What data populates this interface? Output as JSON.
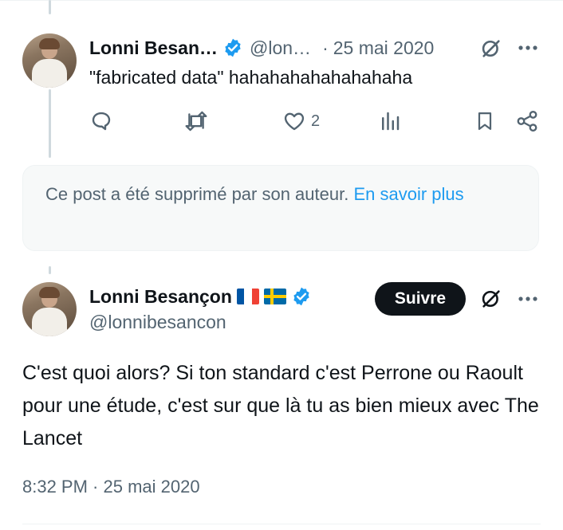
{
  "reply": {
    "author_name": "Lonni Besan…",
    "author_handle": "@lon…",
    "separator": "·",
    "date": "25 mai 2020",
    "text": "\"fabricated data\" hahahahahahahahaha",
    "likes": "2"
  },
  "deleted_notice": {
    "text": "Ce post a été supprimé par son auteur.",
    "link": "En savoir plus"
  },
  "main_tweet": {
    "author_name": "Lonni Besançon",
    "author_handle": "@lonnibesancon",
    "follow_label": "Suivre",
    "text": "C'est quoi alors? Si ton standard c'est Perrone ou Raoult pour une étude, c'est sur que là tu as bien mieux avec The Lancet",
    "timestamp": "8:32 PM · 25 mai 2020"
  },
  "colors": {
    "verified": "#1d9bf0",
    "muted": "#536471",
    "link": "#1d9bf0"
  },
  "icons": [
    "verified-badge-icon",
    "grok-icon",
    "more-icon",
    "reply-icon",
    "repost-icon",
    "like-icon",
    "views-icon",
    "bookmark-icon",
    "share-icon",
    "flag-france-icon",
    "flag-sweden-icon"
  ]
}
